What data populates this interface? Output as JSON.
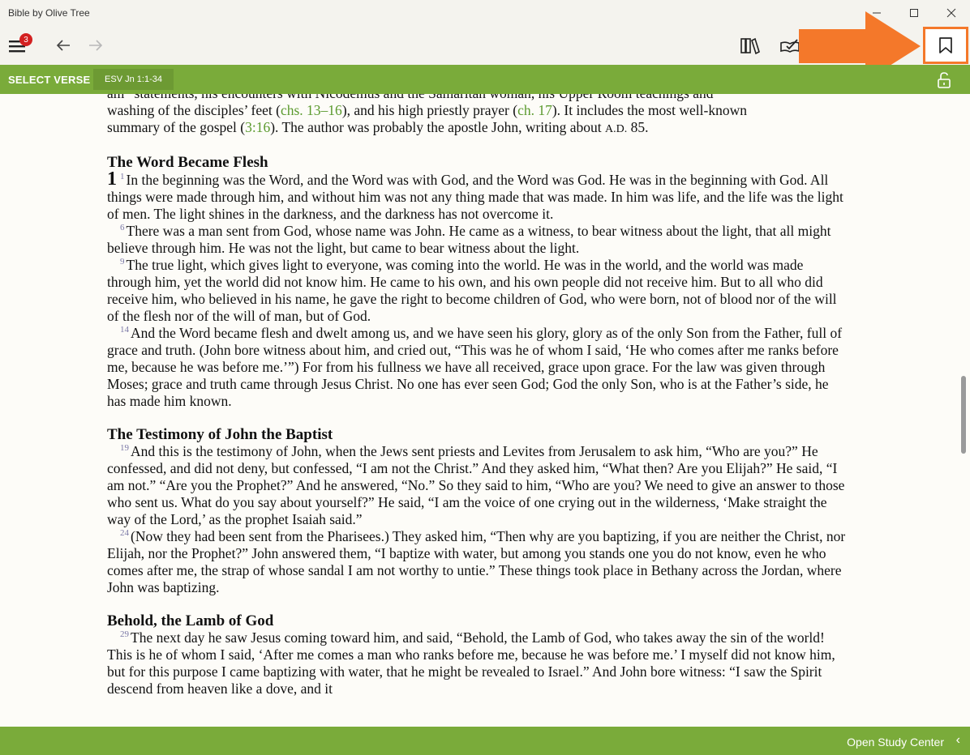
{
  "window": {
    "title": "Bible by Olive Tree"
  },
  "toolbar": {
    "notification_count": "3"
  },
  "greenbar": {
    "select_verse": "SELECT VERSE",
    "reference": "ESV Jn 1:1-34"
  },
  "footer": {
    "study_center": "Open Study Center",
    "chevron": "‹"
  },
  "colors": {
    "accent_green": "#7aab3a",
    "highlight_orange": "#f4782a",
    "badge_red": "#d32020",
    "verse_number": "#7a78a6",
    "footnote": "#6f9c3a"
  },
  "intro": {
    "l1": "am” statements, his encounters with Nicodemus and the Samaritan woman, his Upper Room teachings and",
    "l2a": "washing of the disciples’ feet (",
    "l2link1": "chs. 13–16",
    "l2b": "), and his high priestly prayer (",
    "l2link2": "ch. 17",
    "l2c": "). It includes the most well-known",
    "l3a": "summary of the gospel (",
    "l3link": "3:16",
    "l3b": "). The author was probably the apostle John, writing about ",
    "l3c": "A.D.",
    "l3d": " 85."
  },
  "sections": {
    "s1": "The Word Became Flesh",
    "s2": "The Testimony of John the Baptist",
    "s3": "Behold, the Lamb of God"
  },
  "verses": {
    "p1": "In the beginning was the Word, and the Word was with God, and the Word was God. He was in the beginning with God. All things were made through him, and without him was not any thing made that was made. In him was life, and the life was the light of men. The light shines in the darkness, and the darkness has not overcome it.",
    "p2": "There was a man sent from God, whose name was John. He came as a witness, to bear witness about the light, that all might believe through him. He was not the light, but came to bear witness about the light.",
    "p3": "The true light, which gives light to everyone, was coming into the world. He was in the world, and the world was made through him, yet the world did not know him. He came to his own, and his own people did not receive him. But to all who did receive him, who believed in his name, he gave the right to become children of God, who were born, not of blood nor of the will of the flesh nor of the will of man, but of God.",
    "p4": "And the Word became flesh and dwelt among us, and we have seen his glory, glory as of the only Son from the Father, full of grace and truth. (John bore witness about him, and cried out, “This was he of whom I said, ‘He who comes after me ranks before me, because he was before me.’”) For from his fullness we have all received, grace upon grace. For the law was given through Moses; grace and truth came through Jesus Christ. No one has ever seen God; God the only Son, who is at the Father’s side, he has made him known.",
    "p5": "And this is the testimony of John, when the Jews sent priests and Levites from Jerusalem to ask him, “Who are you?” He confessed, and did not deny, but confessed, “I am not the Christ.” And they asked him, “What then? Are you Elijah?” He said, “I am not.” “Are you the Prophet?” And he answered, “No.” So they said to him, “Who are you? We need to give an answer to those who sent us. What do you say about yourself?” He said, “I am the voice of one crying out in the wilderness, ‘Make straight the way of the Lord,’ as the prophet Isaiah said.”",
    "p6": "(Now they had been sent from the Pharisees.) They asked him, “Then why are you baptizing, if you are neither the Christ, nor Elijah, nor the Prophet?” John answered them, “I baptize with water, but among you stands one you do not know, even he who comes after me, the strap of whose sandal I am not worthy to untie.” These things took place in Bethany across the Jordan, where John was baptizing.",
    "p7": "The next day he saw Jesus coming toward him, and said, “Behold, the Lamb of God, who takes away the sin of the world! This is he of whom I said, ‘After me comes a man who ranks before me, because he was before me.’ I myself did not know him, but for this purpose I came baptizing with water, that he might be revealed to Israel.” And John bore witness: “I saw the Spirit descend from heaven like a dove, and it"
  }
}
